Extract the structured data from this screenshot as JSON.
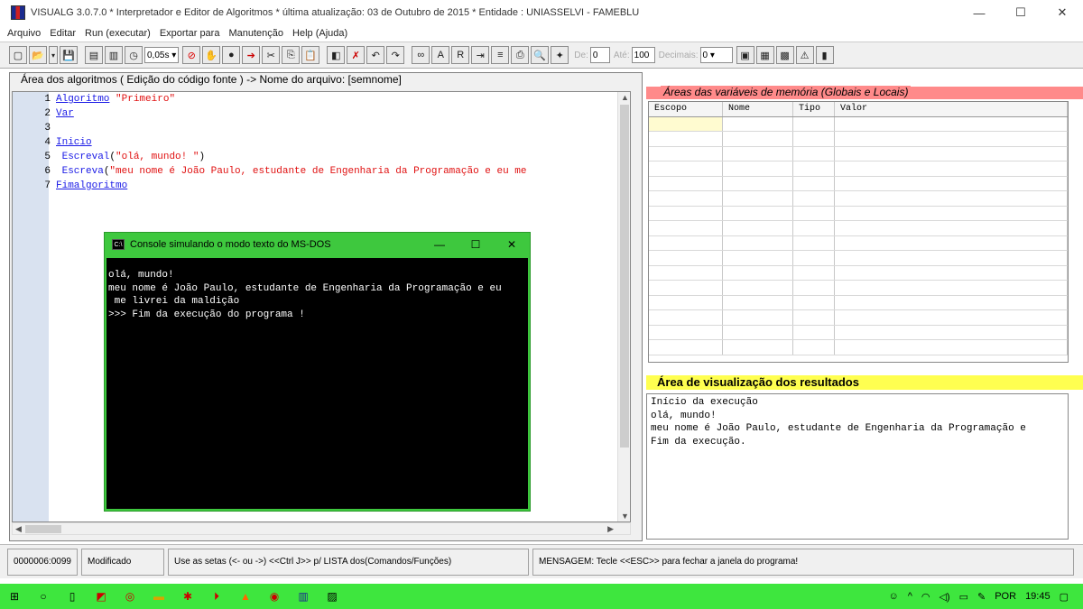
{
  "window": {
    "title": "VISUALG 3.0.7.0 * Interpretador e Editor de Algoritmos * última atualização: 03 de Outubro de 2015 * Entidade : UNIASSELVI - FAMEBLU",
    "minimize": "—",
    "maximize": "☐",
    "close": "✕"
  },
  "menu": [
    "Arquivo",
    "Editar",
    "Run (executar)",
    "Exportar para",
    "Manutenção",
    "Help (Ajuda)"
  ],
  "toolbar": {
    "speed": "0,05s",
    "de_label": "De:",
    "de_value": "0",
    "ate_label": "Até:",
    "ate_value": "100",
    "decimais_label": "Decimais:",
    "decimais_value": "0"
  },
  "algo": {
    "header": "Área dos algoritmos ( Edição do código fonte ) -> Nome do arquivo: [semnome]",
    "lines": [
      {
        "n": "1",
        "kw": "Algoritmo",
        "rest": " ",
        "str": "\"Primeiro\""
      },
      {
        "n": "2",
        "kw": "Var",
        "rest": "",
        "str": ""
      },
      {
        "n": "3",
        "kw": "",
        "rest": "",
        "str": ""
      },
      {
        "n": "4",
        "kw": "Inicio",
        "rest": "",
        "str": ""
      },
      {
        "n": "5",
        "kw": "",
        "fn": " Escreval",
        "rest": "(",
        "str": "\"olá, mundo! \"",
        "tail": ")"
      },
      {
        "n": "6",
        "kw": "",
        "fn": " Escreva",
        "rest": "(",
        "str": "\"meu nome é João Paulo, estudante de Engenharia da Programação e eu me",
        "tail": ""
      },
      {
        "n": "7",
        "kw": "Fimalgoritmo",
        "rest": "",
        "str": ""
      }
    ]
  },
  "console": {
    "title": "Console simulando o modo texto do MS-DOS",
    "icon": "C:\\",
    "output": "olá, mundo!\nmeu nome é João Paulo, estudante de Engenharia da Programação e eu\n me livrei da maldição\n>>> Fim da execução do programa !"
  },
  "vars": {
    "title": "Áreas das variáveis de memória (Globais e Locais)",
    "columns": [
      "Escopo",
      "Nome",
      "Tipo",
      "Valor"
    ]
  },
  "results": {
    "title": "Área de visualização dos resultados",
    "output": "Início da execução\nolá, mundo!\nmeu nome é João Paulo, estudante de Engenharia da Programação e\nFim da execução."
  },
  "status": {
    "position": "0000006:0099",
    "state": "Modificado",
    "hint": "Use as setas (<- ou ->) <<Ctrl J>> p/ LISTA dos(Comandos/Funções)",
    "message": "MENSAGEM: Tecle <<ESC>> para fechar a janela do programa!"
  },
  "taskbar": {
    "language": "POR",
    "time": "19:45"
  },
  "colors": {
    "taskbar": "#3ee63e",
    "vars_header": "#ff8a8a",
    "results_header": "#ffff50",
    "keyword": "#1a1ae6",
    "string": "#e01010"
  }
}
